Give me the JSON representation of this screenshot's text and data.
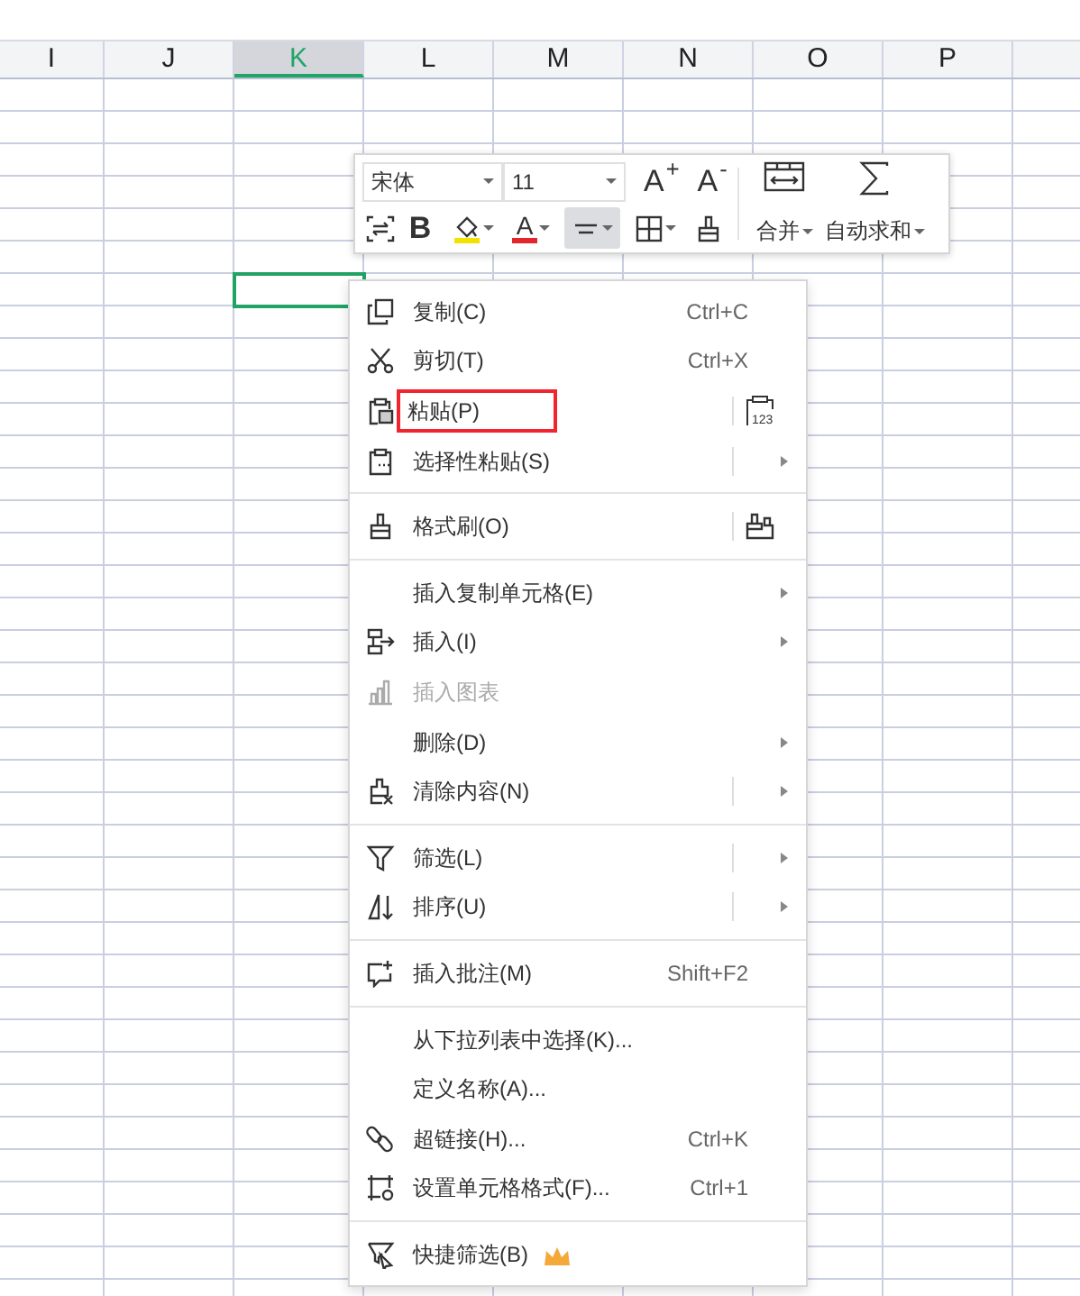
{
  "columns": [
    {
      "label": "I",
      "selected": false
    },
    {
      "label": "J",
      "selected": false
    },
    {
      "label": "K",
      "selected": true
    },
    {
      "label": "L",
      "selected": false
    },
    {
      "label": "M",
      "selected": false
    },
    {
      "label": "N",
      "selected": false
    },
    {
      "label": "O",
      "selected": false
    },
    {
      "label": "P",
      "selected": false
    }
  ],
  "mini_toolbar": {
    "font": "宋体",
    "size": "11",
    "grow_font": "A$^{+}$",
    "shrink_font": "A$^{-}$",
    "bold": "B",
    "color_buttons": [
      {
        "kind": "fill",
        "color": "#f2e200"
      },
      {
        "kind": "font",
        "glyph": "A",
        "color": "#e3262b"
      }
    ],
    "align_pressed": true,
    "merge": "合并",
    "autosum": "自动求和"
  },
  "context_menu": [
    {
      "kind": "item",
      "label": "复制(C)",
      "shortcut": "Ctrl+C"
    },
    {
      "kind": "item",
      "label": "剪切(T)",
      "shortcut": "Ctrl+X"
    },
    {
      "kind": "item",
      "label": "粘贴(P)",
      "boxed": true,
      "split": true,
      "side_icon_text": "123"
    },
    {
      "kind": "item",
      "label": "选择性粘贴(S)",
      "split": true,
      "submenu": true
    },
    {
      "kind": "separator"
    },
    {
      "kind": "item",
      "label": "格式刷(O)",
      "split": true
    },
    {
      "kind": "separator"
    },
    {
      "kind": "item",
      "label": "插入复制单元格(E)",
      "submenu": true
    },
    {
      "kind": "item",
      "label": "插入(I)",
      "submenu": true
    },
    {
      "kind": "item",
      "label": "插入图表",
      "disabled": true
    },
    {
      "kind": "item",
      "label": "删除(D)",
      "submenu": true
    },
    {
      "kind": "item",
      "label": "清除内容(N)",
      "split": true,
      "submenu": true
    },
    {
      "kind": "separator"
    },
    {
      "kind": "item",
      "label": "筛选(L)",
      "split": true,
      "submenu": true
    },
    {
      "kind": "item",
      "label": "排序(U)",
      "split": true,
      "submenu": true
    },
    {
      "kind": "separator"
    },
    {
      "kind": "item",
      "label": "插入批注(M)",
      "shortcut": "Shift+F2"
    },
    {
      "kind": "separator"
    },
    {
      "kind": "item",
      "label": "从下拉列表中选择(K)..."
    },
    {
      "kind": "item",
      "label": "定义名称(A)..."
    },
    {
      "kind": "item",
      "label": "超链接(H)...",
      "shortcut": "Ctrl+K"
    },
    {
      "kind": "item",
      "label": "设置单元格格式(F)...",
      "shortcut": "Ctrl+1"
    },
    {
      "kind": "separator"
    },
    {
      "kind": "item",
      "label": "快捷筛选(B)",
      "premium": true
    }
  ]
}
